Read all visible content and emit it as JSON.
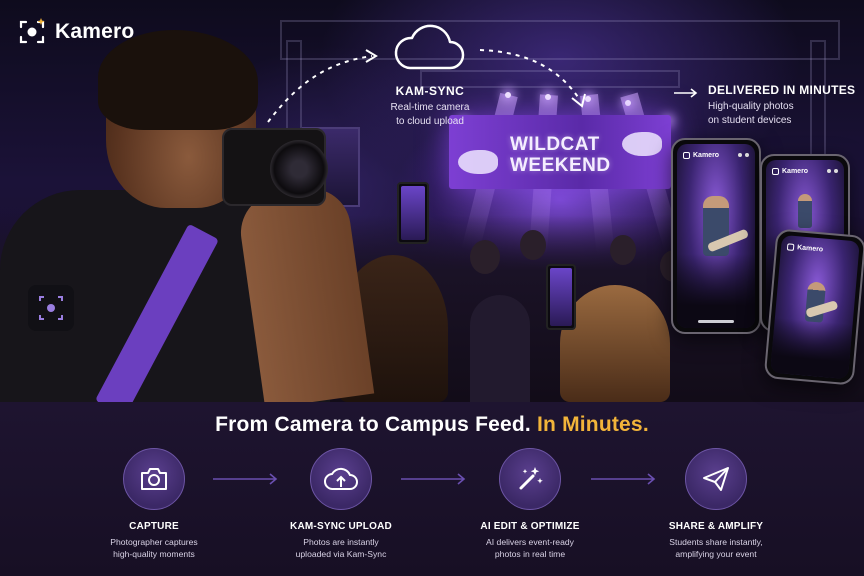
{
  "brand": {
    "name": "Kamero"
  },
  "hero": {
    "sync": {
      "title": "KAM-SYNC",
      "subtitle_line1": "Real-time camera",
      "subtitle_line2": "to cloud upload"
    },
    "delivered": {
      "title": "DELIVERED IN MINUTES",
      "subtitle_line1": "High-quality photos",
      "subtitle_line2": "on student devices"
    },
    "stage_banner": {
      "line1": "WILDCAT",
      "line2": "WEEKEND"
    },
    "phones": [
      {
        "app_label": "Kamero"
      },
      {
        "app_label": "Kamero"
      },
      {
        "app_label": "Kamero"
      }
    ]
  },
  "headline": {
    "main": "From Camera to Campus Feed.",
    "accent": "In Minutes."
  },
  "steps": [
    {
      "icon": "camera-icon",
      "title": "CAPTURE",
      "line1": "Photographer captures",
      "line2": "high-quality moments"
    },
    {
      "icon": "cloud-upload-icon",
      "title": "KAM-SYNC UPLOAD",
      "line1": "Photos are instantly",
      "line2": "uploaded via Kam-Sync"
    },
    {
      "icon": "magic-wand-icon",
      "title": "AI EDIT & OPTIMIZE",
      "line1": "AI delivers event-ready",
      "line2": "photos in real time"
    },
    {
      "icon": "paper-plane-icon",
      "title": "SHARE & AMPLIFY",
      "line1": "Students share instantly,",
      "line2": "amplifying your event"
    }
  ],
  "colors": {
    "accent_gold": "#f2b43a",
    "brand_purple": "#6b3fbf",
    "panel_bg": "#1e1430"
  }
}
